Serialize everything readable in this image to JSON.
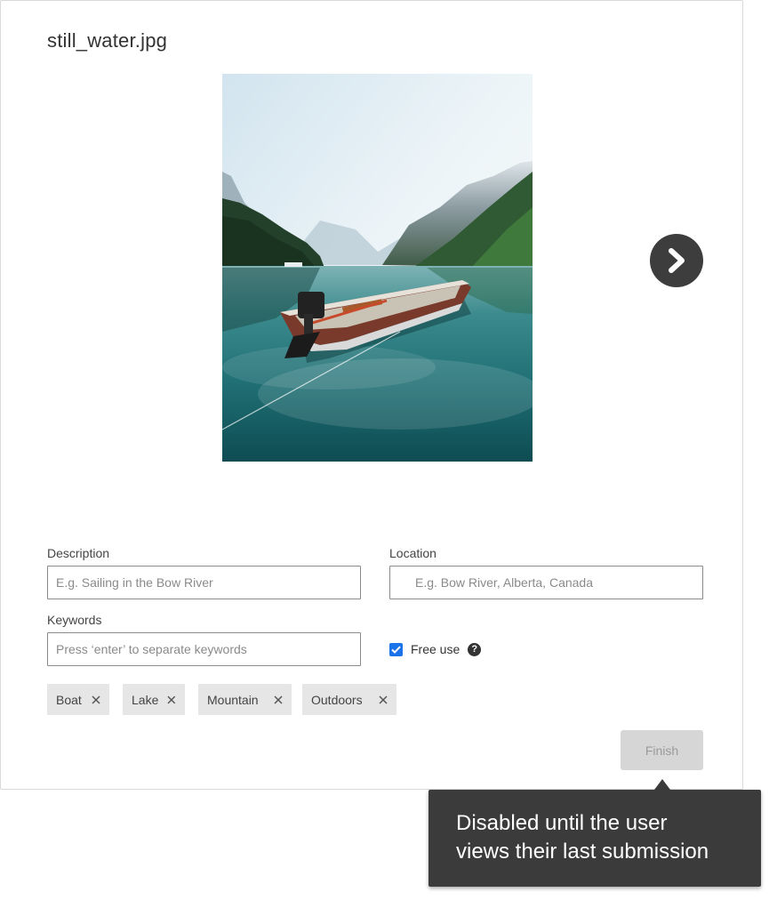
{
  "file": {
    "name": "still_water.jpg"
  },
  "image": {
    "alt": "still_water.jpg"
  },
  "navigation": {
    "next_icon": "chevron-right-icon"
  },
  "form": {
    "description": {
      "label": "Description",
      "placeholder": "E.g. Sailing in the Bow River",
      "value": ""
    },
    "location": {
      "label": "Location",
      "placeholder": "E.g. Bow River, Alberta, Canada",
      "value": "",
      "icon": "map-pin-icon"
    },
    "keywords": {
      "label": "Keywords",
      "placeholder": "Press ‘enter’ to separate keywords",
      "value": ""
    },
    "free_use": {
      "label": "Free use",
      "checked": true,
      "help_icon": "question-circle-icon",
      "help_glyph": "?"
    },
    "tags": [
      {
        "label": "Boat"
      },
      {
        "label": "Lake"
      },
      {
        "label": "Mountain"
      },
      {
        "label": "Outdoors"
      }
    ],
    "finish": {
      "label": "Finish",
      "disabled": true
    }
  },
  "tooltip": {
    "text_line1": "Disabled until the user",
    "text_line2": "views their last submission"
  },
  "colors": {
    "accent": "#1a73e8",
    "dark": "#3b3b3b",
    "disabled_bg": "#d6d6d6",
    "disabled_text": "#9a9a9a",
    "tag_bg": "#e6e6e6"
  }
}
